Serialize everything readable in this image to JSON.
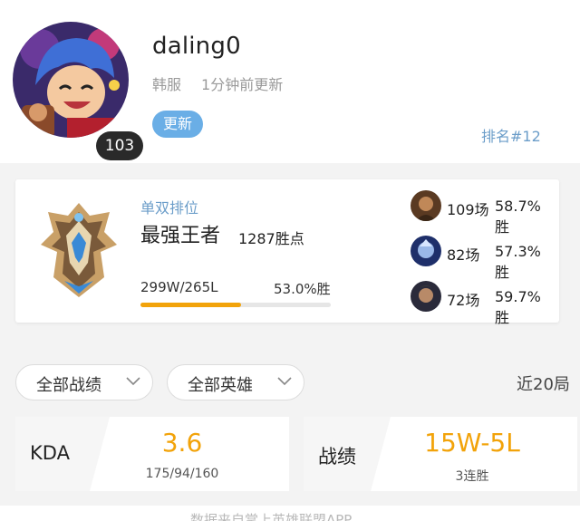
{
  "profile": {
    "username": "daling0",
    "server": "韩服",
    "updated": "1分钟前更新",
    "level": "103",
    "update_button": "更新",
    "rank": "排名#12"
  },
  "ranked": {
    "queue": "单双排位",
    "tier": "最强王者",
    "points": "1287胜点",
    "record": "299W/265L",
    "win_rate": "53.0%胜",
    "win_rate_value": 0.53,
    "champions": [
      {
        "games": "109场",
        "win_rate": "58.7%胜",
        "icon": "champion-portrait-1"
      },
      {
        "games": "82场",
        "win_rate": "57.3%胜",
        "icon": "champion-portrait-2"
      },
      {
        "games": "72场",
        "win_rate": "59.7%胜",
        "icon": "champion-portrait-3"
      }
    ]
  },
  "filters": {
    "matches": "全部战绩",
    "champions": "全部英雄",
    "recent": "近20局"
  },
  "stats": {
    "kda": {
      "title": "KDA",
      "value": "3.6",
      "detail": "175/94/160"
    },
    "record": {
      "title": "战绩",
      "value": "15W-5L",
      "detail": "3连胜"
    }
  },
  "bottom": {
    "text": "数据来自掌上英雄联盟APP"
  },
  "colors": {
    "accent": "#f2a30a",
    "link": "#6b9dc9",
    "button": "#6aaee6"
  }
}
